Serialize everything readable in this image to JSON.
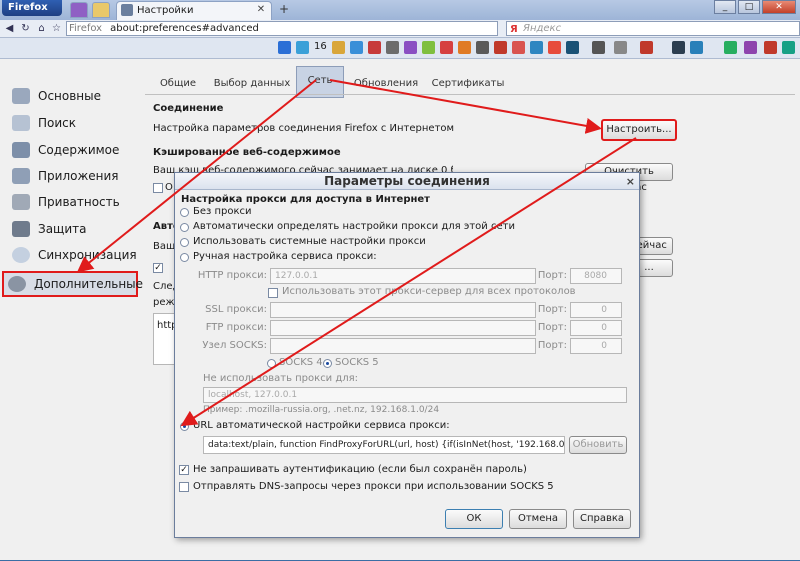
{
  "browser": {
    "firefox_button": "Firefox",
    "tab_title": "Настройки",
    "url_site": "Firefox",
    "url": "about:preferences#advanced",
    "search_placeholder": "Яндекс",
    "toolbar_badge": "16"
  },
  "sidebar": {
    "items": [
      {
        "label": "Основные"
      },
      {
        "label": "Поиск"
      },
      {
        "label": "Содержимое"
      },
      {
        "label": "Приложения"
      },
      {
        "label": "Приватность"
      },
      {
        "label": "Защита"
      },
      {
        "label": "Синхронизация"
      },
      {
        "label": "Дополнительные"
      }
    ]
  },
  "pref_tabs": [
    "Общие",
    "Выбор данных",
    "Сеть",
    "Обновления",
    "Сертификаты"
  ],
  "network": {
    "connection_header": "Соединение",
    "connection_desc": "Настройка параметров соединения Firefox с Интернетом",
    "configure_button": "Настроить...",
    "cache_header": "Кэшированное веб-содержимое",
    "cache_desc_partial": "Ваш кэш веб-содержимого сейчас занимает на диске 0 байт",
    "clear_now_button": "Очистить сейчас",
    "partial_o": "О",
    "partial_auto": "Авто",
    "partial_vash": "Ваш",
    "partial_sled": "След",
    "partial_rezh": "реж",
    "partial_http": "http",
    "side_button_1": "сейчас",
    "side_button_2": "..."
  },
  "dialog": {
    "title": "Параметры соединения",
    "close": "×",
    "section": "Настройка прокси для доступа в Интернет",
    "radio_no_proxy": "Без прокси",
    "radio_auto_detect": "Автоматически определять настройки прокси для этой сети",
    "radio_system": "Использовать системные настройки прокси",
    "radio_manual": "Ручная настройка сервиса прокси:",
    "http_proxy_label": "HTTP прокси:",
    "http_proxy_value": "127.0.0.1",
    "port_label": "Порт:",
    "http_port_value": "8080",
    "use_for_all": "Использовать этот прокси-сервер для всех протоколов",
    "ssl_label": "SSL прокси:",
    "ftp_label": "FTP прокси:",
    "socks_label": "Узел SOCKS:",
    "zero": "0",
    "socks4": "SOCKS 4",
    "socks5": "SOCKS 5",
    "no_proxy_label": "Не использовать прокси для:",
    "no_proxy_value": "localhost, 127.0.0.1",
    "example": "Пример: .mozilla-russia.org, .net.nz, 192.168.1.0/24",
    "radio_pac": "URL автоматической настройки сервиса прокси:",
    "pac_value": "data:text/plain, function FindProxyForURL(url, host) {if(isInNet(host, '192.168.0.0', '25",
    "reload_button": "Обновить",
    "no_auth_prompt": "Не запрашивать аутентификацию (если был сохранён пароль)",
    "socks_dns": "Отправлять DNS-запросы через прокси при использовании SOCKS 5",
    "ok_button": "ОК",
    "cancel_button": "Отмена",
    "help_button": "Справка"
  },
  "colors": {
    "highlight": "#e01b1b",
    "selected_tab": "#c8d3e4"
  }
}
